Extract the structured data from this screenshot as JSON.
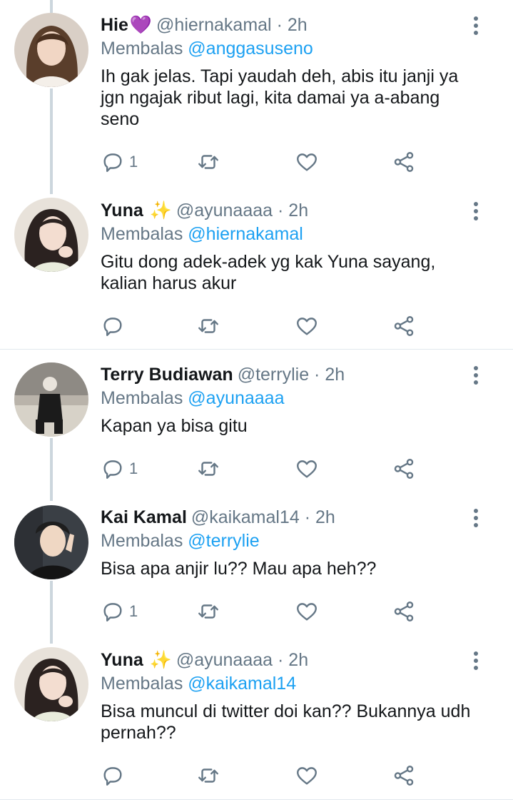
{
  "tweets": [
    {
      "name": "Hie",
      "emoji": "💜",
      "handle": "@hiernakamal",
      "time": "· 2h",
      "replying_prefix": "Membalas",
      "replying_to": "@anggasuseno",
      "lines": [
        "Ih gak jelas. Tapi yaudah deh, abis itu janji ya",
        "jgn ngajak ribut lagi, kita damai ya a-abang",
        "seno"
      ],
      "reply_count": "1"
    },
    {
      "name": "Yuna",
      "emoji": "✨",
      "handle": "@ayunaaaa",
      "time": "· 2h",
      "replying_prefix": "Membalas",
      "replying_to": "@hiernakamal",
      "lines": [
        "Gitu dong adek-adek yg kak Yuna sayang,",
        "kalian harus akur"
      ],
      "reply_count": ""
    },
    {
      "name": "Terry Budiawan",
      "emoji": "",
      "handle": "@terrylie",
      "time": "· 2h",
      "replying_prefix": "Membalas",
      "replying_to": "@ayunaaaa",
      "lines": [
        "Kapan ya bisa gitu"
      ],
      "reply_count": "1"
    },
    {
      "name": "Kai Kamal",
      "emoji": "",
      "handle": "@kaikamal14",
      "time": "· 2h",
      "replying_prefix": "Membalas",
      "replying_to": "@terrylie",
      "lines": [
        "Bisa apa anjir lu?? Mau apa heh??"
      ],
      "reply_count": "1"
    },
    {
      "name": "Yuna",
      "emoji": "✨",
      "handle": "@ayunaaaa",
      "time": "· 2h",
      "replying_prefix": "Membalas",
      "replying_to": "@kaikamal14",
      "lines": [
        "Bisa muncul di twitter doi kan?? Bukannya udh",
        "pernah??"
      ],
      "reply_count": ""
    }
  ],
  "icons": {
    "reply": "reply-icon",
    "retweet": "retweet-icon",
    "like": "heart-icon",
    "share": "share-icon",
    "more": "more-vertical-icon"
  },
  "colors": {
    "text": "#14171a",
    "secondary": "#657786",
    "link": "#1da1f2",
    "thread_line": "#ccd6dd",
    "divider": "#e1e8ed"
  }
}
